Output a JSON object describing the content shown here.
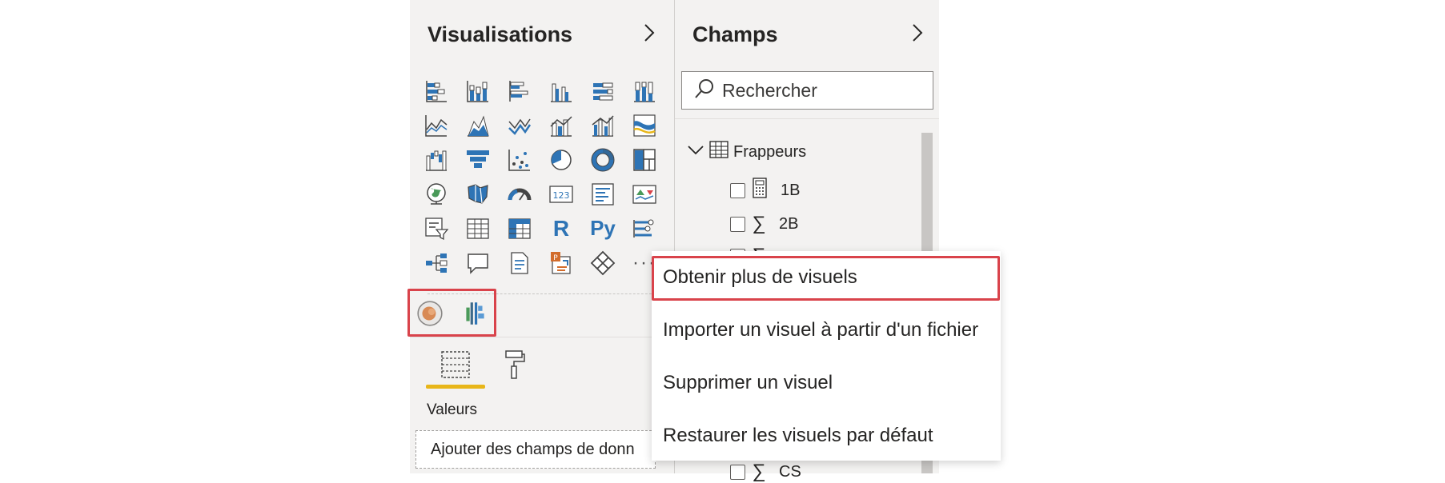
{
  "colors": {
    "accent_blue": "#2e74b5",
    "highlight_red": "#d9434b",
    "pane_bg": "#f3f2f1",
    "tab_underline": "#e8b619"
  },
  "visualizations": {
    "title": "Visualisations",
    "icons": [
      "stacked-bar-chart-icon",
      "stacked-column-chart-icon",
      "clustered-bar-chart-icon",
      "clustered-column-chart-icon",
      "100-stacked-bar-chart-icon",
      "100-stacked-column-chart-icon",
      "line-chart-icon",
      "area-chart-icon",
      "stacked-area-chart-icon",
      "line-and-stacked-column-chart-icon",
      "line-and-clustered-column-chart-icon",
      "ribbon-chart-icon",
      "waterfall-chart-icon",
      "funnel-chart-icon",
      "scatter-chart-icon",
      "pie-chart-icon",
      "donut-chart-icon",
      "treemap-icon",
      "map-icon",
      "filled-map-icon",
      "gauge-icon",
      "card-icon",
      "multi-row-card-icon",
      "kpi-icon",
      "slicer-icon",
      "table-icon",
      "matrix-icon",
      "r-script-visual-icon",
      "python-visual-icon",
      "key-influencers-icon",
      "decomposition-tree-icon",
      "qa-icon",
      "smart-narrative-icon",
      "paginated-report-icon",
      "power-apps-icon",
      "more-visuals-icon"
    ],
    "r_glyph": "R",
    "py_glyph": "Py",
    "more_glyph": "···",
    "custom_icons": [
      "custom-visual-circle-icon",
      "custom-visual-bars-icon"
    ],
    "tabs": [
      "fields-tab-icon",
      "format-paint-roller-icon"
    ],
    "values_label": "Valeurs",
    "add_fields_placeholder": "Ajouter des champs de donn"
  },
  "fields": {
    "title": "Champs",
    "search_placeholder": "Rechercher",
    "table_name": "Frappeurs",
    "items": [
      {
        "name": "1B",
        "icon": "calculator-icon"
      },
      {
        "name": "2B",
        "icon": "sigma-icon"
      },
      {
        "name": "",
        "icon": "sigma-icon"
      },
      {
        "name": "CS",
        "icon": "sigma-icon"
      }
    ]
  },
  "context_menu": {
    "items": [
      "Obtenir plus de visuels",
      "Importer un visuel à partir d'un fichier",
      "Supprimer un visuel",
      "Restaurer les visuels par défaut"
    ]
  }
}
